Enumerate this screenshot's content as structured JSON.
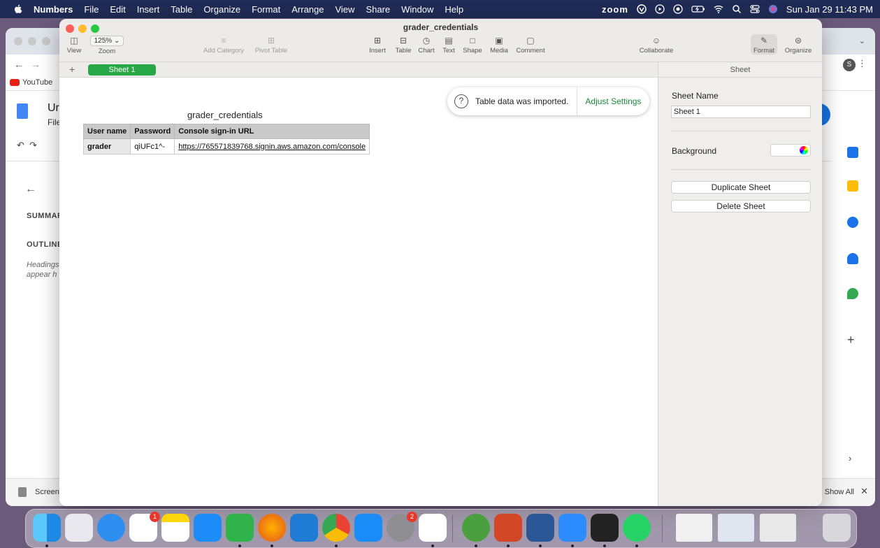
{
  "menubar": {
    "app": "Numbers",
    "items": [
      "File",
      "Edit",
      "Insert",
      "Table",
      "Organize",
      "Format",
      "Arrange",
      "View",
      "Share",
      "Window",
      "Help"
    ],
    "zoom_label": "zoom",
    "clock": "Sun Jan 29  11:43 PM"
  },
  "background_window": {
    "bookmark": "YouTube",
    "doc_title": "Ur",
    "doc_menu": "File",
    "sidebar_summary": "SUMMAR",
    "sidebar_outline": "OUTLINE",
    "sidebar_hint_1": "Headings",
    "sidebar_hint_2": "appear h",
    "avatar_letter": "S",
    "bottom_item": "Screen",
    "show_all": "Show All"
  },
  "numbers": {
    "window_title": "grader_credentials",
    "toolbar": {
      "view": "View",
      "zoom_value": "125%",
      "zoom": "Zoom",
      "add_category": "Add Category",
      "pivot_table": "Pivot Table",
      "insert": "Insert",
      "table": "Table",
      "chart": "Chart",
      "text": "Text",
      "shape": "Shape",
      "media": "Media",
      "comment": "Comment",
      "collaborate": "Collaborate",
      "format": "Format",
      "organize": "Organize"
    },
    "sheet_tab": "Sheet 1",
    "table_title": "grader_credentials",
    "table": {
      "headers": [
        "User name",
        "Password",
        "Console sign-in URL"
      ],
      "rows": [
        [
          "grader",
          "qiUFc1^-",
          "https://765571839768.signin.aws.amazon.com/console"
        ]
      ]
    },
    "toast": {
      "message": "Table data was imported.",
      "action": "Adjust Settings"
    },
    "sidebar": {
      "header": "Sheet",
      "sheet_name_label": "Sheet Name",
      "sheet_name_value": "Sheet 1",
      "background_label": "Background",
      "duplicate": "Duplicate Sheet",
      "delete": "Delete Sheet"
    }
  },
  "dock": {
    "reminders_badge": "1",
    "settings_badge": "2"
  }
}
